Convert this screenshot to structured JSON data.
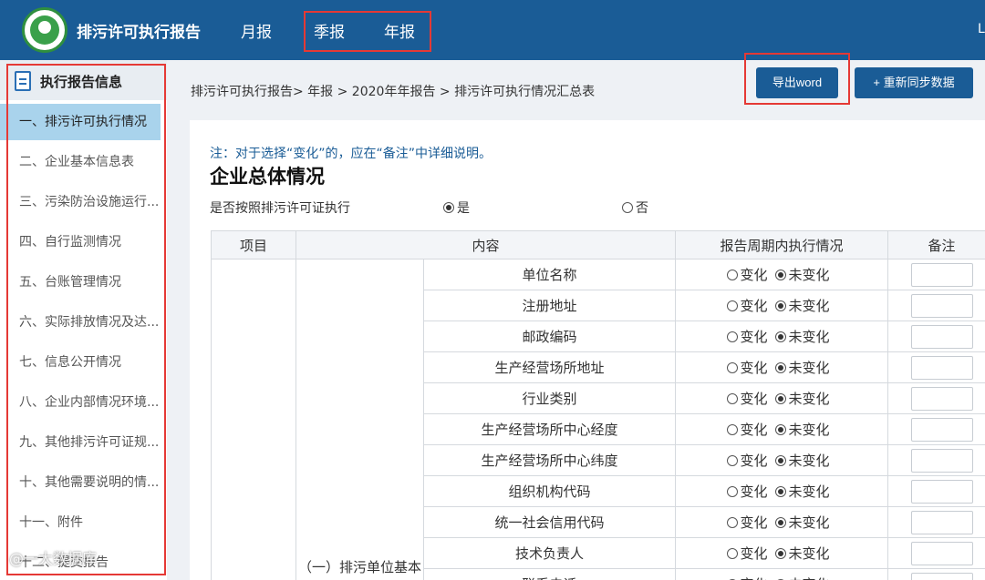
{
  "header": {
    "title": "排污许可执行报告",
    "nav": [
      "月报",
      "季报",
      "年报"
    ],
    "user_initial": "L"
  },
  "sidebar": {
    "title": "执行报告信息",
    "items": [
      "一、排污许可执行情况",
      "二、企业基本信息表",
      "三、污染防治设施运行...",
      "四、自行监测情况",
      "五、台账管理情况",
      "六、实际排放情况及达...",
      "七、信息公开情况",
      "八、企业内部情况环境...",
      "九、其他排污许可证规...",
      "十、其他需要说明的情...",
      "十一、附件",
      "十二、提交报告"
    ],
    "active_index": 0
  },
  "watermark": "@一大数据库",
  "breadcrumb": "排污许可执行报告> 年报 > 2020年年报告 > 排污许可执行情况汇总表",
  "buttons": {
    "export_word": "导出word",
    "resync": "+ 重新同步数据"
  },
  "main": {
    "note": "注：对于选择“变化”的，应在“备注”中详细说明。",
    "section_title": "企业总体情况",
    "permit_question": "是否按照排污许可证执行",
    "permit_yes": "是",
    "permit_no": "否",
    "permit_selected": "是",
    "table": {
      "headers": [
        "项目",
        "内容",
        "报告周期内执行情况",
        "备注"
      ],
      "group_label": "（一）排污单位基本信息",
      "option_changed": "变化",
      "option_unchanged": "未变化",
      "rows": [
        "单位名称",
        "注册地址",
        "邮政编码",
        "生产经营场所地址",
        "行业类别",
        "生产经营场所中心经度",
        "生产经营场所中心纬度",
        "组织机构代码",
        "统一社会信用代码",
        "技术负责人",
        "联系电话"
      ],
      "selected_option": "未变化"
    }
  },
  "colors": {
    "header_bg": "#1a5c96",
    "button_bg": "#1a5c96",
    "active_item_bg": "#a9d3ec",
    "highlight_box": "#e53935",
    "note_text": "#1a5c96"
  }
}
